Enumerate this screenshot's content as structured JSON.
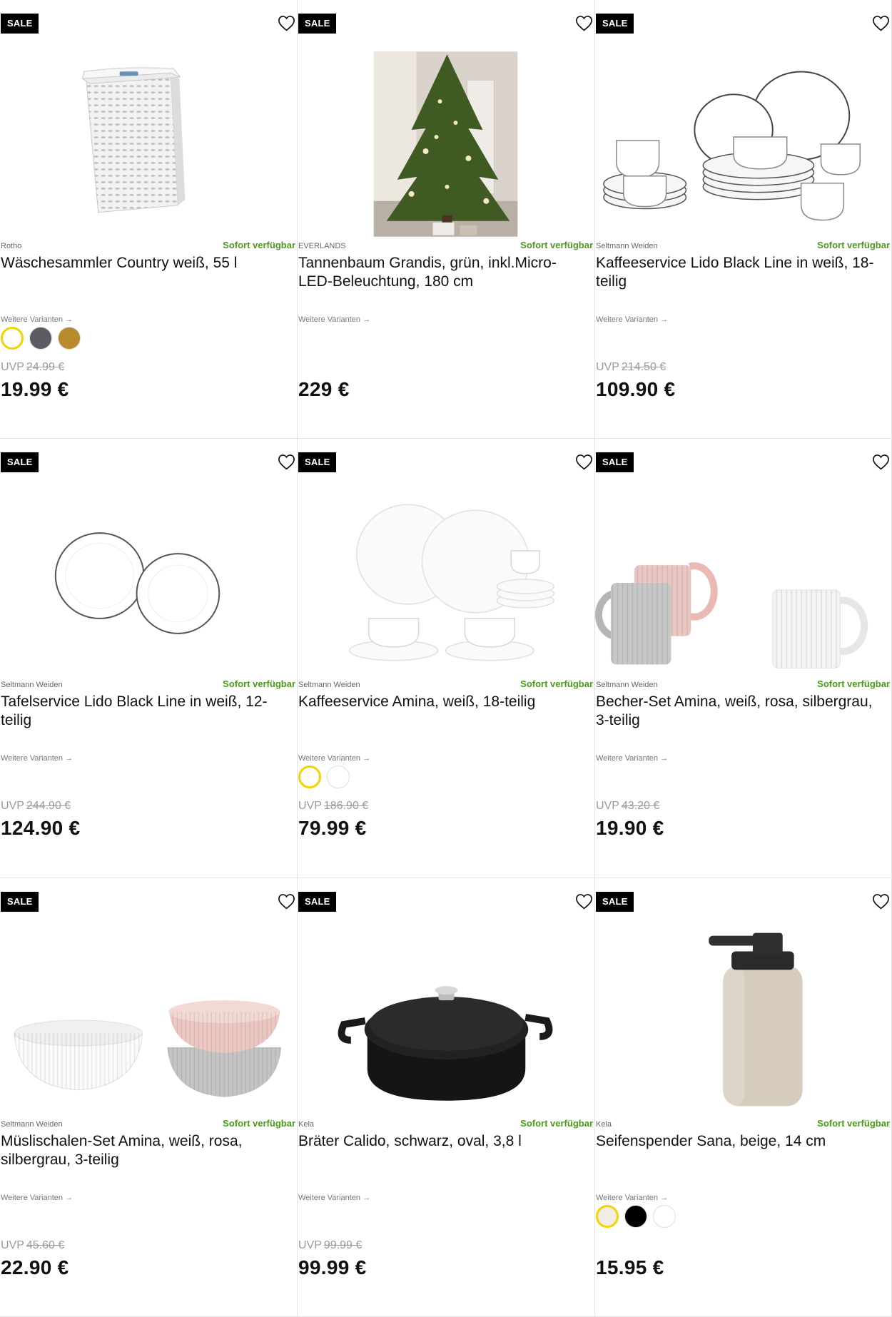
{
  "labels": {
    "sale": "SALE",
    "available": "Sofort verfügbar",
    "variants": "Weitere Varianten →",
    "uvp_prefix": "UVP"
  },
  "products": [
    {
      "brand": "Rotho",
      "title": "Wäschesammler Country weiß, 55 l",
      "uvp": "24.99 €",
      "price": "19.99 €",
      "image": "laundry-basket",
      "swatches": [
        "#ffffff",
        "#5b5d62",
        "#b88a2e"
      ]
    },
    {
      "brand": "EVERLANDS",
      "title": "Tannenbaum Grandis, grün, inkl.Micro-LED-Beleuchtung, 180 cm",
      "uvp": "",
      "price": "229 €",
      "image": "christmas-tree",
      "swatches": []
    },
    {
      "brand": "Seltmann Weiden",
      "title": "Kaffeeservice Lido Black Line in weiß, 18-teilig",
      "uvp": "214.50 €",
      "price": "109.90 €",
      "image": "coffee-set-black-line",
      "swatches": []
    },
    {
      "brand": "Seltmann Weiden",
      "title": "Tafelservice Lido Black Line in weiß, 12-teilig",
      "uvp": "244.90 €",
      "price": "124.90 €",
      "image": "dinner-plates",
      "swatches": []
    },
    {
      "brand": "Seltmann Weiden",
      "title": "Kaffeeservice Amina, weiß, 18-teilig",
      "uvp": "186.90 €",
      "price": "79.99 €",
      "image": "coffee-set-amina",
      "swatches": [
        "#ffffff",
        "#ffffff"
      ]
    },
    {
      "brand": "Seltmann Weiden",
      "title": "Becher-Set Amina, weiß, rosa, silbergrau, 3-teilig",
      "uvp": "43.20 €",
      "price": "19.90 €",
      "image": "mug-set",
      "swatches": []
    },
    {
      "brand": "Seltmann Weiden",
      "title": "Müslischalen-Set Amina, weiß, rosa, silbergrau, 3-teilig",
      "uvp": "45.60 €",
      "price": "22.90 €",
      "image": "bowl-set",
      "swatches": []
    },
    {
      "brand": "Kela",
      "title": "Bräter Calido, schwarz, oval, 3,8 l",
      "uvp": "99.99 €",
      "price": "99.99 €",
      "image": "cast-iron-pot",
      "swatches": []
    },
    {
      "brand": "Kela",
      "title": "Seifenspender Sana, beige, 14 cm",
      "uvp": "",
      "price": "15.95 €",
      "image": "soap-dispenser",
      "swatches": [
        "#f1ede4",
        "#000000",
        "#ffffff"
      ]
    }
  ]
}
